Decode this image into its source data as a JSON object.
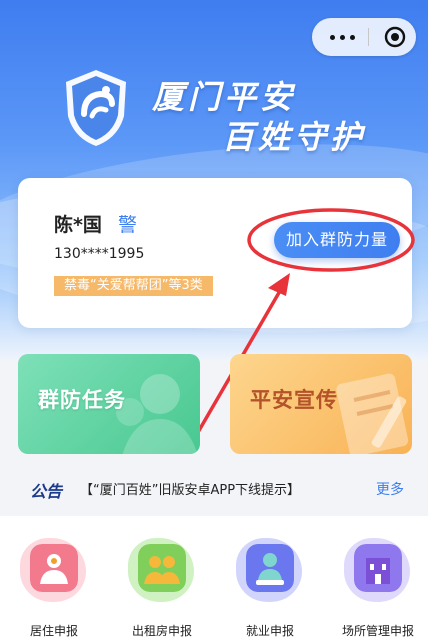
{
  "header": {
    "title_line1": "厦门平安",
    "title_line2": "百姓守护"
  },
  "capsule": {
    "more_icon": "more-dots-icon",
    "close_icon": "target-close-icon"
  },
  "user_card": {
    "name": "陈*国",
    "badge": "警",
    "phone": "130****1995",
    "tag": "禁毒“关爱帮帮团”等3类",
    "join_button": "加入群防力量"
  },
  "tiles": [
    {
      "label": "群防任务",
      "color": "#49c891"
    },
    {
      "label": "平安宣传",
      "color": "#f9b255"
    }
  ],
  "notice": {
    "label": "公告",
    "text": "【“厦门百姓”旧版安卓APP下线提示】",
    "more": "更多"
  },
  "services": [
    {
      "label": "居住申报",
      "icon": "resident-icon"
    },
    {
      "label": "出租房申报",
      "icon": "rental-icon"
    },
    {
      "label": "就业申报",
      "icon": "employment-icon"
    },
    {
      "label": "场所管理申报",
      "icon": "building-icon"
    }
  ],
  "colors": {
    "accent": "#3f7ef0",
    "annotation": "#e8333a"
  }
}
